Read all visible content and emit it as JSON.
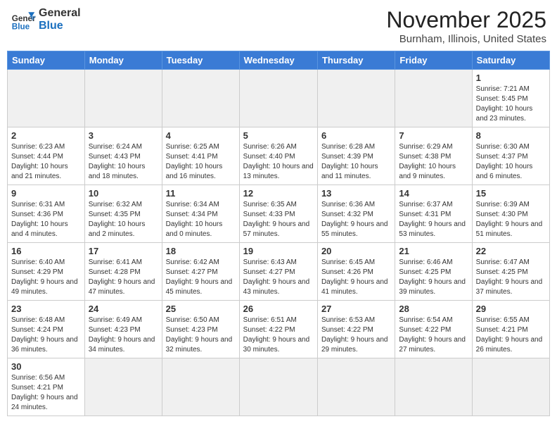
{
  "header": {
    "logo_general": "General",
    "logo_blue": "Blue",
    "month": "November 2025",
    "location": "Burnham, Illinois, United States"
  },
  "days_of_week": [
    "Sunday",
    "Monday",
    "Tuesday",
    "Wednesday",
    "Thursday",
    "Friday",
    "Saturday"
  ],
  "weeks": [
    [
      {
        "day": "",
        "info": ""
      },
      {
        "day": "",
        "info": ""
      },
      {
        "day": "",
        "info": ""
      },
      {
        "day": "",
        "info": ""
      },
      {
        "day": "",
        "info": ""
      },
      {
        "day": "",
        "info": ""
      },
      {
        "day": "1",
        "info": "Sunrise: 7:21 AM\nSunset: 5:45 PM\nDaylight: 10 hours and 23 minutes."
      }
    ],
    [
      {
        "day": "2",
        "info": "Sunrise: 6:23 AM\nSunset: 4:44 PM\nDaylight: 10 hours and 21 minutes."
      },
      {
        "day": "3",
        "info": "Sunrise: 6:24 AM\nSunset: 4:43 PM\nDaylight: 10 hours and 18 minutes."
      },
      {
        "day": "4",
        "info": "Sunrise: 6:25 AM\nSunset: 4:41 PM\nDaylight: 10 hours and 16 minutes."
      },
      {
        "day": "5",
        "info": "Sunrise: 6:26 AM\nSunset: 4:40 PM\nDaylight: 10 hours and 13 minutes."
      },
      {
        "day": "6",
        "info": "Sunrise: 6:28 AM\nSunset: 4:39 PM\nDaylight: 10 hours and 11 minutes."
      },
      {
        "day": "7",
        "info": "Sunrise: 6:29 AM\nSunset: 4:38 PM\nDaylight: 10 hours and 9 minutes."
      },
      {
        "day": "8",
        "info": "Sunrise: 6:30 AM\nSunset: 4:37 PM\nDaylight: 10 hours and 6 minutes."
      }
    ],
    [
      {
        "day": "9",
        "info": "Sunrise: 6:31 AM\nSunset: 4:36 PM\nDaylight: 10 hours and 4 minutes."
      },
      {
        "day": "10",
        "info": "Sunrise: 6:32 AM\nSunset: 4:35 PM\nDaylight: 10 hours and 2 minutes."
      },
      {
        "day": "11",
        "info": "Sunrise: 6:34 AM\nSunset: 4:34 PM\nDaylight: 10 hours and 0 minutes."
      },
      {
        "day": "12",
        "info": "Sunrise: 6:35 AM\nSunset: 4:33 PM\nDaylight: 9 hours and 57 minutes."
      },
      {
        "day": "13",
        "info": "Sunrise: 6:36 AM\nSunset: 4:32 PM\nDaylight: 9 hours and 55 minutes."
      },
      {
        "day": "14",
        "info": "Sunrise: 6:37 AM\nSunset: 4:31 PM\nDaylight: 9 hours and 53 minutes."
      },
      {
        "day": "15",
        "info": "Sunrise: 6:39 AM\nSunset: 4:30 PM\nDaylight: 9 hours and 51 minutes."
      }
    ],
    [
      {
        "day": "16",
        "info": "Sunrise: 6:40 AM\nSunset: 4:29 PM\nDaylight: 9 hours and 49 minutes."
      },
      {
        "day": "17",
        "info": "Sunrise: 6:41 AM\nSunset: 4:28 PM\nDaylight: 9 hours and 47 minutes."
      },
      {
        "day": "18",
        "info": "Sunrise: 6:42 AM\nSunset: 4:27 PM\nDaylight: 9 hours and 45 minutes."
      },
      {
        "day": "19",
        "info": "Sunrise: 6:43 AM\nSunset: 4:27 PM\nDaylight: 9 hours and 43 minutes."
      },
      {
        "day": "20",
        "info": "Sunrise: 6:45 AM\nSunset: 4:26 PM\nDaylight: 9 hours and 41 minutes."
      },
      {
        "day": "21",
        "info": "Sunrise: 6:46 AM\nSunset: 4:25 PM\nDaylight: 9 hours and 39 minutes."
      },
      {
        "day": "22",
        "info": "Sunrise: 6:47 AM\nSunset: 4:25 PM\nDaylight: 9 hours and 37 minutes."
      }
    ],
    [
      {
        "day": "23",
        "info": "Sunrise: 6:48 AM\nSunset: 4:24 PM\nDaylight: 9 hours and 36 minutes."
      },
      {
        "day": "24",
        "info": "Sunrise: 6:49 AM\nSunset: 4:23 PM\nDaylight: 9 hours and 34 minutes."
      },
      {
        "day": "25",
        "info": "Sunrise: 6:50 AM\nSunset: 4:23 PM\nDaylight: 9 hours and 32 minutes."
      },
      {
        "day": "26",
        "info": "Sunrise: 6:51 AM\nSunset: 4:22 PM\nDaylight: 9 hours and 30 minutes."
      },
      {
        "day": "27",
        "info": "Sunrise: 6:53 AM\nSunset: 4:22 PM\nDaylight: 9 hours and 29 minutes."
      },
      {
        "day": "28",
        "info": "Sunrise: 6:54 AM\nSunset: 4:22 PM\nDaylight: 9 hours and 27 minutes."
      },
      {
        "day": "29",
        "info": "Sunrise: 6:55 AM\nSunset: 4:21 PM\nDaylight: 9 hours and 26 minutes."
      }
    ],
    [
      {
        "day": "30",
        "info": "Sunrise: 6:56 AM\nSunset: 4:21 PM\nDaylight: 9 hours and 24 minutes."
      },
      {
        "day": "",
        "info": ""
      },
      {
        "day": "",
        "info": ""
      },
      {
        "day": "",
        "info": ""
      },
      {
        "day": "",
        "info": ""
      },
      {
        "day": "",
        "info": ""
      },
      {
        "day": "",
        "info": ""
      }
    ]
  ]
}
